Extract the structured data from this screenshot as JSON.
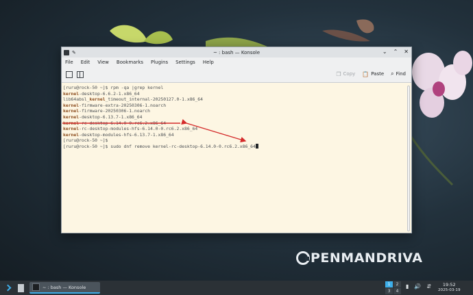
{
  "desktop": {
    "logo_text": "PENMANDRIVA"
  },
  "window": {
    "title": "~ : bash — Konsole",
    "controls": [
      "⌄",
      "⌃",
      "✕"
    ],
    "menu": [
      "File",
      "Edit",
      "View",
      "Bookmarks",
      "Plugins",
      "Settings",
      "Help"
    ],
    "toolbar": {
      "copy_label": "Copy",
      "paste_label": "Paste",
      "find_label": "Find"
    }
  },
  "terminal": {
    "lines": [
      {
        "pre": "[ruru@rock-50 ~]$ rpm -qa |grep kernel",
        "hl": "",
        "post": ""
      },
      {
        "pre": "",
        "hl": "kernel",
        "post": "-desktop-6.6.2-1.x86_64"
      },
      {
        "pre": "lib64absl_",
        "hl": "kernel",
        "post": "_timeout_internal-20250127.0-1.x86_64"
      },
      {
        "pre": "",
        "hl": "kernel",
        "post": "-firmware-extra-20250306-1.noarch"
      },
      {
        "pre": "",
        "hl": "kernel",
        "post": "-firmware-20250306-1.noarch"
      },
      {
        "pre": "",
        "hl": "kernel",
        "post": "-desktop-6.13.7-1.x86_64"
      },
      {
        "pre": "",
        "hl": "kernel",
        "post": "-rc-desktop-6.14.0-0.rc6.2.x86_64"
      },
      {
        "pre": "",
        "hl": "kernel",
        "post": "-rc-desktop-modules-hfs-6.14.0-0.rc6.2.x86_64"
      },
      {
        "pre": "",
        "hl": "kernel",
        "post": "-desktop-modules-hfs-6.13.7-1.x86_64"
      },
      {
        "pre": "[ruru@rock-50 ~]$",
        "hl": "",
        "post": ""
      },
      {
        "pre": "[ruru@rock-50 ~]$ sudo dnf remove kernel-rc-desktop-6.14.0-0.rc6.2.x86_64",
        "hl": "",
        "post": ""
      }
    ]
  },
  "taskbar": {
    "task_label": "~ : bash — Konsole",
    "pager": [
      "1",
      "2",
      "3",
      "4"
    ],
    "clock_time": "19:52",
    "clock_date": "2025-03-19"
  },
  "colors": {
    "annotation": "#d42a2a",
    "accent": "#3daee9"
  }
}
